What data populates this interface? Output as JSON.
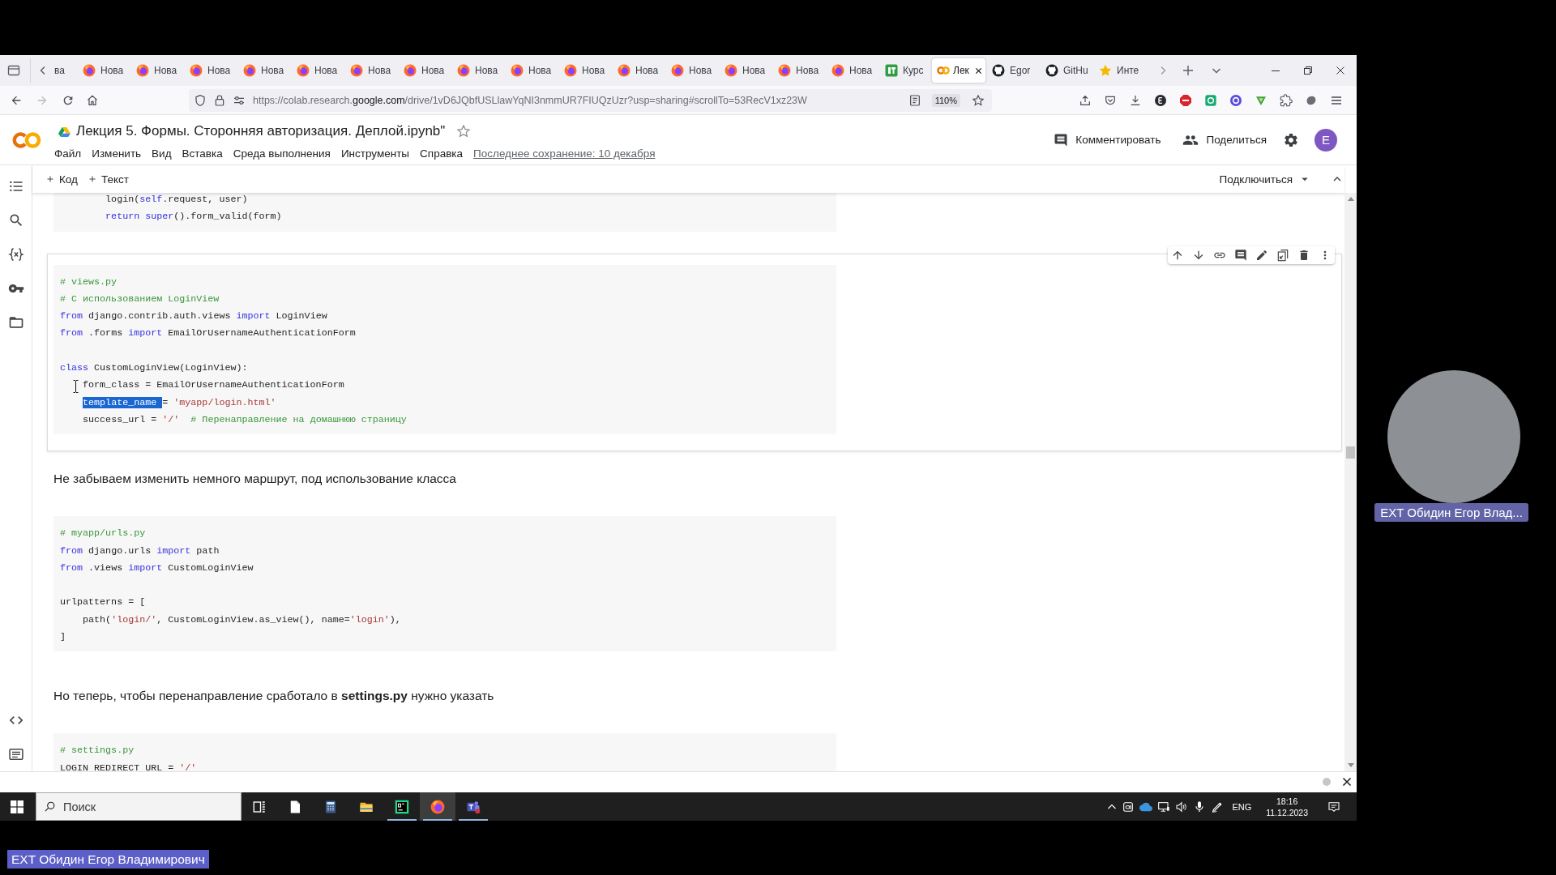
{
  "browser": {
    "tabs": [
      {
        "title": "ва",
        "selected": false
      },
      {
        "title": "Нова",
        "kind": "fox",
        "selected": false
      },
      {
        "title": "Нова",
        "kind": "fox",
        "selected": false
      },
      {
        "title": "Нова",
        "kind": "fox",
        "selected": false
      },
      {
        "title": "Нова",
        "kind": "fox",
        "selected": false
      },
      {
        "title": "Нова",
        "kind": "fox",
        "selected": false
      },
      {
        "title": "Нова",
        "kind": "fox",
        "selected": false
      },
      {
        "title": "Нова",
        "kind": "fox",
        "selected": false
      },
      {
        "title": "Нова",
        "kind": "fox",
        "selected": false
      },
      {
        "title": "Нова",
        "kind": "fox",
        "selected": false
      },
      {
        "title": "Нова",
        "kind": "fox",
        "selected": false
      },
      {
        "title": "Нова",
        "kind": "fox",
        "selected": false
      },
      {
        "title": "Нова",
        "kind": "fox",
        "selected": false
      },
      {
        "title": "Нова",
        "kind": "fox",
        "selected": false
      },
      {
        "title": "Нова",
        "kind": "fox",
        "selected": false
      },
      {
        "title": "Нова",
        "kind": "fox",
        "selected": false
      },
      {
        "title": "Курс",
        "kind": "tile",
        "selected": false
      },
      {
        "title": "Лек",
        "kind": "rings",
        "selected": true
      },
      {
        "title": "Egor",
        "kind": "cat",
        "selected": false
      },
      {
        "title": "GitHu",
        "kind": "cat",
        "selected": false
      },
      {
        "title": "Инте",
        "kind": "star",
        "selected": false
      }
    ],
    "url": {
      "prefix": "https://colab.research.",
      "domain": "google.com",
      "path": "/drive/1vD6JQbfUSLlawYqNI3nmmUR7FIUQzUzr?usp=sharing#scrollTo=53RecV1xz23W"
    },
    "zoom": "110%"
  },
  "notebook": {
    "title": "Лекция 5. Формы. Сторонняя авторизация. Деплой.ipynb\"",
    "menu": [
      "Файл",
      "Изменить",
      "Вид",
      "Вставка",
      "Среда выполнения",
      "Инструменты",
      "Справка"
    ],
    "last_saved": "Последнее сохранение: 10 декабря",
    "comment": "Комментировать",
    "share": "Поделиться",
    "avatar": "E",
    "add_code": "Код",
    "add_text": "Текст",
    "connect": "Подключиться"
  },
  "cells": [
    {
      "kind": "code",
      "selected": false,
      "blocks": [
        [
          [
            {
              "kind": "plain",
              "text": "        login("
            },
            {
              "kind": "keyword",
              "text": "self"
            },
            {
              "kind": "plain",
              "text": ".request, user)"
            }
          ],
          [
            {
              "kind": "keyword",
              "text": "        return"
            },
            {
              "kind": "keyword",
              "text": " super"
            },
            {
              "kind": "plain",
              "text": "().form_valid(form)"
            }
          ]
        ]
      ]
    },
    {
      "kind": "code",
      "selected": true,
      "blocks": [
        [
          [
            {
              "kind": "comment",
              "text": "# views.py"
            }
          ],
          [
            {
              "kind": "comment",
              "text": "# С использованием LoginView"
            }
          ],
          [
            {
              "kind": "keyword",
              "text": "from"
            },
            {
              "kind": "plain",
              "text": " django.contrib.auth.views "
            },
            {
              "kind": "keyword",
              "text": "import"
            },
            {
              "kind": "plain",
              "text": " LoginView"
            }
          ],
          [
            {
              "kind": "keyword",
              "text": "from"
            },
            {
              "kind": "plain",
              "text": " .forms "
            },
            {
              "kind": "keyword",
              "text": "import"
            },
            {
              "kind": "plain",
              "text": " EmailOrUsernameAuthenticationForm"
            }
          ]
        ],
        [
          [
            {
              "kind": "keyword",
              "text": "class"
            },
            {
              "kind": "plain",
              "text": " CustomLoginView(LoginView):"
            }
          ],
          [
            {
              "kind": "plain",
              "text": "    form_class = EmailOrUsernameAuthenticationForm"
            }
          ],
          [
            {
              "kind": "selection",
              "text": "    template_name "
            },
            {
              "kind": "plain",
              "text": "= "
            },
            {
              "kind": "string",
              "text": "'myapp/login.html'"
            }
          ],
          [
            {
              "kind": "plain",
              "text": "    success_url = "
            },
            {
              "kind": "string",
              "text": "'/'"
            },
            {
              "kind": "comment",
              "text": "  # Перенаправление на домашнюю страницу"
            }
          ]
        ]
      ]
    },
    {
      "kind": "text",
      "selected": false,
      "text": "Не забываем изменить немного маршрут, под использование класса"
    },
    {
      "kind": "code",
      "selected": false,
      "blocks": [
        [
          [
            {
              "kind": "comment",
              "text": "# myapp/urls.py"
            }
          ],
          [
            {
              "kind": "keyword",
              "text": "from"
            },
            {
              "kind": "plain",
              "text": " django.urls "
            },
            {
              "kind": "keyword",
              "text": "import"
            },
            {
              "kind": "plain",
              "text": " path"
            }
          ],
          [
            {
              "kind": "keyword",
              "text": "from"
            },
            {
              "kind": "plain",
              "text": " .views "
            },
            {
              "kind": "keyword",
              "text": "import"
            },
            {
              "kind": "plain",
              "text": " CustomLoginView"
            }
          ]
        ],
        [
          [
            {
              "kind": "plain",
              "text": "urlpatterns = ["
            }
          ],
          [
            {
              "kind": "plain",
              "text": "    path("
            },
            {
              "kind": "string",
              "text": "'login/'"
            },
            {
              "kind": "plain",
              "text": ", CustomLoginView.as_view(), name="
            },
            {
              "kind": "string",
              "text": "'login'"
            },
            {
              "kind": "plain",
              "text": "),"
            }
          ],
          [
            {
              "kind": "plain",
              "text": "]"
            }
          ]
        ]
      ]
    },
    {
      "kind": "text",
      "selected": false,
      "text": "Но теперь, чтобы перенаправление сработало в **settings.py** нужно указать"
    },
    {
      "kind": "code",
      "selected": false,
      "blocks": [
        [
          [
            {
              "kind": "comment",
              "text": "# settings.py"
            }
          ],
          [
            {
              "kind": "plain",
              "text": "LOGIN REDIRECT URL = "
            },
            {
              "kind": "string",
              "text": "'/'"
            }
          ]
        ]
      ]
    }
  ],
  "taskbar": {
    "search_placeholder": "Поиск",
    "apps": [
      {
        "kind": "task_view",
        "selected": false,
        "running": false
      },
      {
        "kind": "file",
        "selected": false,
        "running": false
      },
      {
        "kind": "calculator",
        "selected": false,
        "running": false
      },
      {
        "kind": "explorer",
        "selected": false,
        "running": false
      },
      {
        "kind": "pycharm",
        "selected": false,
        "running": true
      },
      {
        "kind": "firefox",
        "selected": true,
        "running": true
      },
      {
        "kind": "teams",
        "selected": false,
        "running": true
      }
    ],
    "language": "ENG",
    "time": "18:16",
    "date": "11.12.2023"
  },
  "meeting": {
    "tile_label": "EXT Обидин Егор Влад...",
    "presenter_label": "EXT Обидин Егор Владимирович"
  }
}
